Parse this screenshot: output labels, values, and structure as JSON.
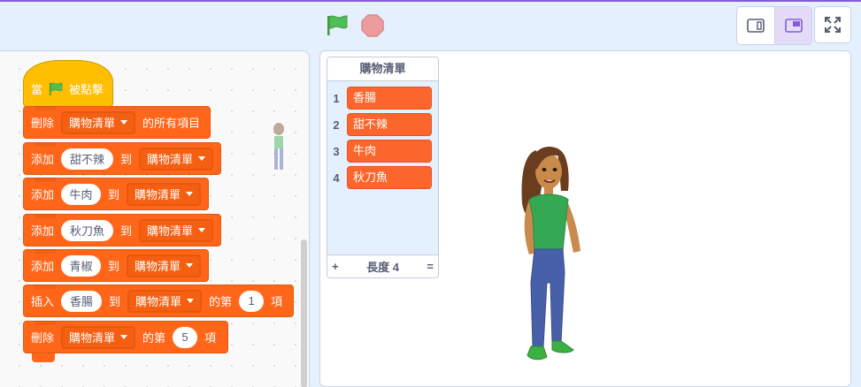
{
  "header": {
    "green_flag": "green-flag-icon",
    "stop": "stop-icon",
    "small_stage": "small-stage-icon",
    "normal_stage": "normal-stage-icon",
    "fullscreen": "fullscreen-icon"
  },
  "colors": {
    "accent": "#855cd6",
    "events_block": "#ffbf00",
    "list_block": "#ff6619",
    "list_item": "#fc662c",
    "background": "#e5f0ff"
  },
  "script": {
    "hat": {
      "when": "當",
      "clicked": "被點擊"
    },
    "blocks": [
      {
        "op": "刪除",
        "list": "購物清單",
        "suffix": "的所有項目"
      },
      {
        "op": "添加",
        "item": "甜不辣",
        "to": "到",
        "list": "購物清單"
      },
      {
        "op": "添加",
        "item": "牛肉",
        "to": "到",
        "list": "購物清單"
      },
      {
        "op": "添加",
        "item": "秋刀魚",
        "to": "到",
        "list": "購物清單"
      },
      {
        "op": "添加",
        "item": "青椒",
        "to": "到",
        "list": "購物清單"
      },
      {
        "op": "插入",
        "item": "香腸",
        "to": "到",
        "list": "購物清單",
        "at": "的第",
        "index": "1",
        "unit": "項"
      },
      {
        "op": "刪除",
        "list": "購物清單",
        "at": "的第",
        "index": "5",
        "unit": "項"
      }
    ]
  },
  "stage": {
    "list_monitor": {
      "title": "購物清單",
      "items": [
        {
          "index": "1",
          "value": "香腸"
        },
        {
          "index": "2",
          "value": "甜不辣"
        },
        {
          "index": "3",
          "value": "牛肉"
        },
        {
          "index": "4",
          "value": "秋刀魚"
        }
      ],
      "add_label": "+",
      "length_label": "長度",
      "length": "4",
      "resize_label": "="
    }
  }
}
